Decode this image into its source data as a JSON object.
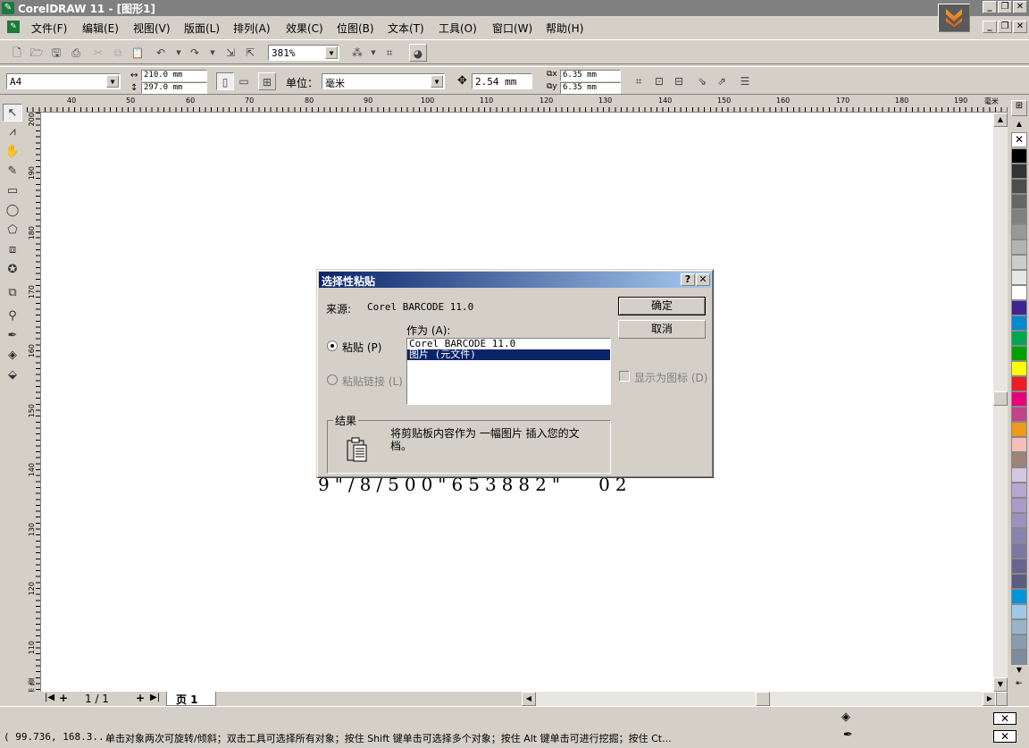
{
  "window": {
    "title": "CorelDRAW 11 - [图形1]"
  },
  "menu": [
    "文件(F)",
    "编辑(E)",
    "视图(V)",
    "版面(L)",
    "排列(A)",
    "效果(C)",
    "位图(B)",
    "文本(T)",
    "工具(O)",
    "窗口(W)",
    "帮助(H)"
  ],
  "toolbar": {
    "zoom": "381%"
  },
  "property_bar": {
    "paper": "A4",
    "width": "210.0 mm",
    "height": "297.0 mm",
    "units_label": "单位：",
    "units": "毫米",
    "nudge": "2.54 mm",
    "dup_x": "6.35 mm",
    "dup_y": "6.35 mm"
  },
  "ruler": {
    "unit": "毫米",
    "top_ticks": [
      "40",
      "50",
      "60",
      "70",
      "80",
      "90",
      "100",
      "110",
      "120",
      "130",
      "140",
      "150",
      "160",
      "170",
      "180",
      "190"
    ],
    "left_ticks": [
      "200",
      "190",
      "180",
      "170",
      "160",
      "150",
      "140",
      "130",
      "120",
      "110"
    ]
  },
  "canvas": {
    "barcode_text": "9\"/8/500\"653882\"   02"
  },
  "dialog": {
    "title": "选择性粘贴",
    "source_label": "来源:",
    "source_value": "Corel BARCODE 11.0",
    "as_label": "作为 (A):",
    "paste_label": "粘贴 (P)",
    "paste_link_label": "粘贴链接 (L)",
    "list_items": [
      "Corel BARCODE 11.0",
      "图片 (元文件)"
    ],
    "ok_button": "确定",
    "cancel_button": "取消",
    "display_as_icon": "显示为图标 (D)",
    "result_label": "结果",
    "result_text": "将剪贴板内容作为 一幅图片 插入您的文档。",
    "help_button": "?",
    "close_button": "✕"
  },
  "pages": {
    "counter": "1 / 1",
    "tab": "页 1"
  },
  "status": {
    "coords": "( 99.736, 168.3...",
    "hint": "单击对象两次可旋转/倾斜；双击工具可选择所有对象；按住 Shift 键单击可选择多个对象；按住 Alt 键单击可进行挖掘；按住 Ct..."
  },
  "palette_colors": [
    "#000000",
    "#333333",
    "#4d4d4d",
    "#666666",
    "#808080",
    "#999999",
    "#b3b3b3",
    "#cccccc",
    "#e6e6e6",
    "#ffffff",
    "#3f2590",
    "#0088d0",
    "#00a650",
    "#00a000",
    "#ffff00",
    "#ee1c24",
    "#e6007e",
    "#c0458a",
    "#ee9a1b",
    "#f6bdb9",
    "#9b8579",
    "#d4c8e0",
    "#b4a8d0",
    "#a89cc8",
    "#9c90c0",
    "#8884b0",
    "#7c78a4",
    "#686490",
    "#5c5c80",
    "#0094d8",
    "#a0c8e8",
    "#98b4cc",
    "#889cb0",
    "#7c8c9c"
  ]
}
